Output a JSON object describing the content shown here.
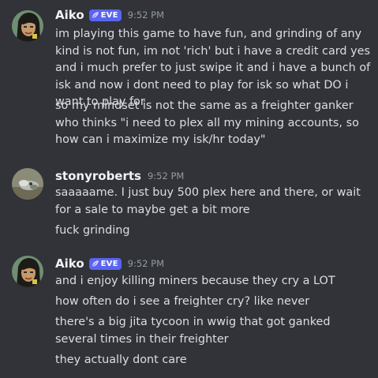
{
  "messages": [
    {
      "author": "Aiko",
      "tag": "EVE",
      "time": "9:52 PM",
      "lines": [
        "im playing this game to have fun, and grinding of any kind is not fun, im not 'rich' but i have a credit card yes and i much prefer to just swipe it and i have a bunch of isk and now i dont need to play for isk so what DO i want to play for",
        "so my mindset is not the same as a freighter ganker who thinks \"i need to plex all my mining accounts, so how can i maximize my isk/hr today\""
      ]
    },
    {
      "author": "stonyroberts",
      "time": "9:52 PM",
      "lines": [
        "saaaaame.  I just buy 500 plex here and there, or wait for a sale to maybe get a bit more",
        "fuck grinding"
      ]
    },
    {
      "author": "Aiko",
      "tag": "EVE",
      "time": "9:52 PM",
      "lines": [
        "and i enjoy killing miners because they cry a LOT",
        "how often do i see a freighter cry? like never",
        "there's a big jita tycoon in wwig that got ganked several times in their freighter",
        "they actually dont care"
      ]
    }
  ],
  "colors": {
    "background": "#313338",
    "text": "#dbdee1",
    "username": "#f2f3f5",
    "timestamp": "#949ba4",
    "tag_background": "#5865f2"
  }
}
